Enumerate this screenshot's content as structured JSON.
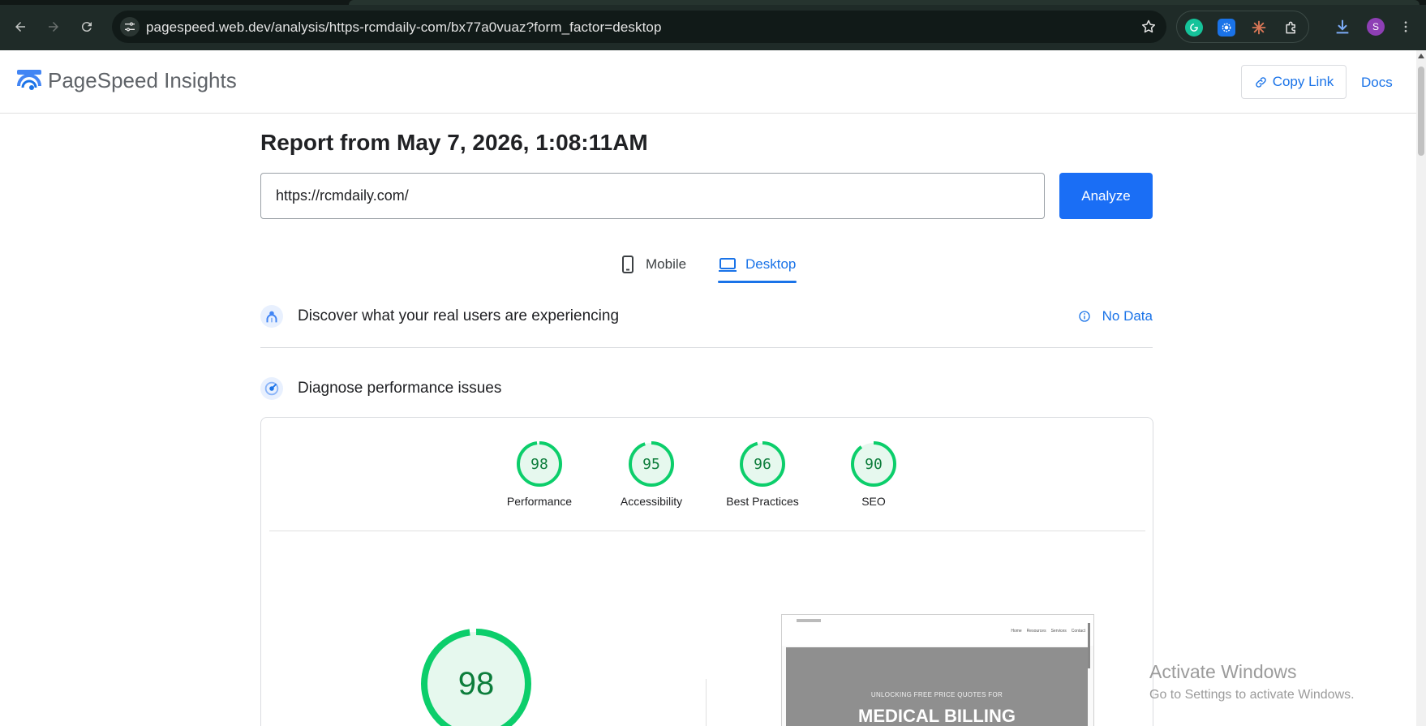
{
  "browser": {
    "url": "pagespeed.web.dev/analysis/https-rcmdaily-com/bx77a0vuaz?form_factor=desktop",
    "profile_initial": "S",
    "icons": {
      "back": "back-arrow-icon",
      "forward": "forward-arrow-icon",
      "reload": "reload-icon",
      "site_info": "tune-icon",
      "bookmark": "star-icon",
      "extensions": [
        "grammarly-icon",
        "extension-gear-icon",
        "claude-icon",
        "puzzle-icon"
      ],
      "download": "download-icon",
      "menu": "more-vert-icon"
    }
  },
  "header": {
    "brand": "PageSpeed Insights",
    "copy_link": "Copy Link",
    "docs": "Docs"
  },
  "report": {
    "title": "Report from May 7, 2026, 1:08:11AM",
    "url_value": "https://rcmdaily.com/",
    "analyze": "Analyze"
  },
  "tabs": {
    "mobile": "Mobile",
    "desktop": "Desktop",
    "active": "desktop"
  },
  "real_users": {
    "label": "Discover what your real users are experiencing",
    "status": "No Data"
  },
  "diagnose": {
    "label": "Diagnose performance issues"
  },
  "scores": [
    {
      "label": "Performance",
      "score": "98"
    },
    {
      "label": "Accessibility",
      "score": "95"
    },
    {
      "label": "Best Practices",
      "score": "96"
    },
    {
      "label": "SEO",
      "score": "90"
    }
  ],
  "main_score": "98",
  "screenshot": {
    "nav_links": [
      "Home",
      "Resources",
      "Services",
      "Contact"
    ],
    "hero_small": "UNLOCKING FREE PRICE QUOTES FOR",
    "hero_big": "MEDICAL BILLING"
  },
  "watermark": {
    "line1": "Activate Windows",
    "line2": "Go to Settings to activate Windows."
  },
  "colors": {
    "accent": "#1a73e8",
    "pass_green": "#0cce6b",
    "pass_text": "#0c7d3b"
  }
}
